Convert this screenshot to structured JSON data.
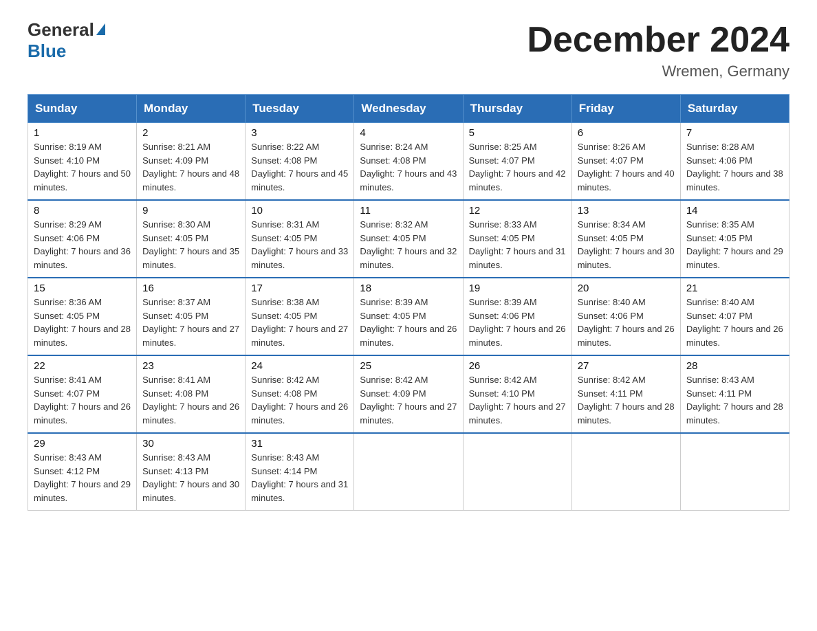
{
  "header": {
    "logo_general": "General",
    "logo_blue": "Blue",
    "title": "December 2024",
    "location": "Wremen, Germany"
  },
  "days_of_week": [
    "Sunday",
    "Monday",
    "Tuesday",
    "Wednesday",
    "Thursday",
    "Friday",
    "Saturday"
  ],
  "weeks": [
    [
      {
        "day": "1",
        "sunrise": "8:19 AM",
        "sunset": "4:10 PM",
        "daylight": "7 hours and 50 minutes."
      },
      {
        "day": "2",
        "sunrise": "8:21 AM",
        "sunset": "4:09 PM",
        "daylight": "7 hours and 48 minutes."
      },
      {
        "day": "3",
        "sunrise": "8:22 AM",
        "sunset": "4:08 PM",
        "daylight": "7 hours and 45 minutes."
      },
      {
        "day": "4",
        "sunrise": "8:24 AM",
        "sunset": "4:08 PM",
        "daylight": "7 hours and 43 minutes."
      },
      {
        "day": "5",
        "sunrise": "8:25 AM",
        "sunset": "4:07 PM",
        "daylight": "7 hours and 42 minutes."
      },
      {
        "day": "6",
        "sunrise": "8:26 AM",
        "sunset": "4:07 PM",
        "daylight": "7 hours and 40 minutes."
      },
      {
        "day": "7",
        "sunrise": "8:28 AM",
        "sunset": "4:06 PM",
        "daylight": "7 hours and 38 minutes."
      }
    ],
    [
      {
        "day": "8",
        "sunrise": "8:29 AM",
        "sunset": "4:06 PM",
        "daylight": "7 hours and 36 minutes."
      },
      {
        "day": "9",
        "sunrise": "8:30 AM",
        "sunset": "4:05 PM",
        "daylight": "7 hours and 35 minutes."
      },
      {
        "day": "10",
        "sunrise": "8:31 AM",
        "sunset": "4:05 PM",
        "daylight": "7 hours and 33 minutes."
      },
      {
        "day": "11",
        "sunrise": "8:32 AM",
        "sunset": "4:05 PM",
        "daylight": "7 hours and 32 minutes."
      },
      {
        "day": "12",
        "sunrise": "8:33 AM",
        "sunset": "4:05 PM",
        "daylight": "7 hours and 31 minutes."
      },
      {
        "day": "13",
        "sunrise": "8:34 AM",
        "sunset": "4:05 PM",
        "daylight": "7 hours and 30 minutes."
      },
      {
        "day": "14",
        "sunrise": "8:35 AM",
        "sunset": "4:05 PM",
        "daylight": "7 hours and 29 minutes."
      }
    ],
    [
      {
        "day": "15",
        "sunrise": "8:36 AM",
        "sunset": "4:05 PM",
        "daylight": "7 hours and 28 minutes."
      },
      {
        "day": "16",
        "sunrise": "8:37 AM",
        "sunset": "4:05 PM",
        "daylight": "7 hours and 27 minutes."
      },
      {
        "day": "17",
        "sunrise": "8:38 AM",
        "sunset": "4:05 PM",
        "daylight": "7 hours and 27 minutes."
      },
      {
        "day": "18",
        "sunrise": "8:39 AM",
        "sunset": "4:05 PM",
        "daylight": "7 hours and 26 minutes."
      },
      {
        "day": "19",
        "sunrise": "8:39 AM",
        "sunset": "4:06 PM",
        "daylight": "7 hours and 26 minutes."
      },
      {
        "day": "20",
        "sunrise": "8:40 AM",
        "sunset": "4:06 PM",
        "daylight": "7 hours and 26 minutes."
      },
      {
        "day": "21",
        "sunrise": "8:40 AM",
        "sunset": "4:07 PM",
        "daylight": "7 hours and 26 minutes."
      }
    ],
    [
      {
        "day": "22",
        "sunrise": "8:41 AM",
        "sunset": "4:07 PM",
        "daylight": "7 hours and 26 minutes."
      },
      {
        "day": "23",
        "sunrise": "8:41 AM",
        "sunset": "4:08 PM",
        "daylight": "7 hours and 26 minutes."
      },
      {
        "day": "24",
        "sunrise": "8:42 AM",
        "sunset": "4:08 PM",
        "daylight": "7 hours and 26 minutes."
      },
      {
        "day": "25",
        "sunrise": "8:42 AM",
        "sunset": "4:09 PM",
        "daylight": "7 hours and 27 minutes."
      },
      {
        "day": "26",
        "sunrise": "8:42 AM",
        "sunset": "4:10 PM",
        "daylight": "7 hours and 27 minutes."
      },
      {
        "day": "27",
        "sunrise": "8:42 AM",
        "sunset": "4:11 PM",
        "daylight": "7 hours and 28 minutes."
      },
      {
        "day": "28",
        "sunrise": "8:43 AM",
        "sunset": "4:11 PM",
        "daylight": "7 hours and 28 minutes."
      }
    ],
    [
      {
        "day": "29",
        "sunrise": "8:43 AM",
        "sunset": "4:12 PM",
        "daylight": "7 hours and 29 minutes."
      },
      {
        "day": "30",
        "sunrise": "8:43 AM",
        "sunset": "4:13 PM",
        "daylight": "7 hours and 30 minutes."
      },
      {
        "day": "31",
        "sunrise": "8:43 AM",
        "sunset": "4:14 PM",
        "daylight": "7 hours and 31 minutes."
      },
      null,
      null,
      null,
      null
    ]
  ],
  "labels": {
    "sunrise_prefix": "Sunrise: ",
    "sunset_prefix": "Sunset: ",
    "daylight_prefix": "Daylight: "
  }
}
